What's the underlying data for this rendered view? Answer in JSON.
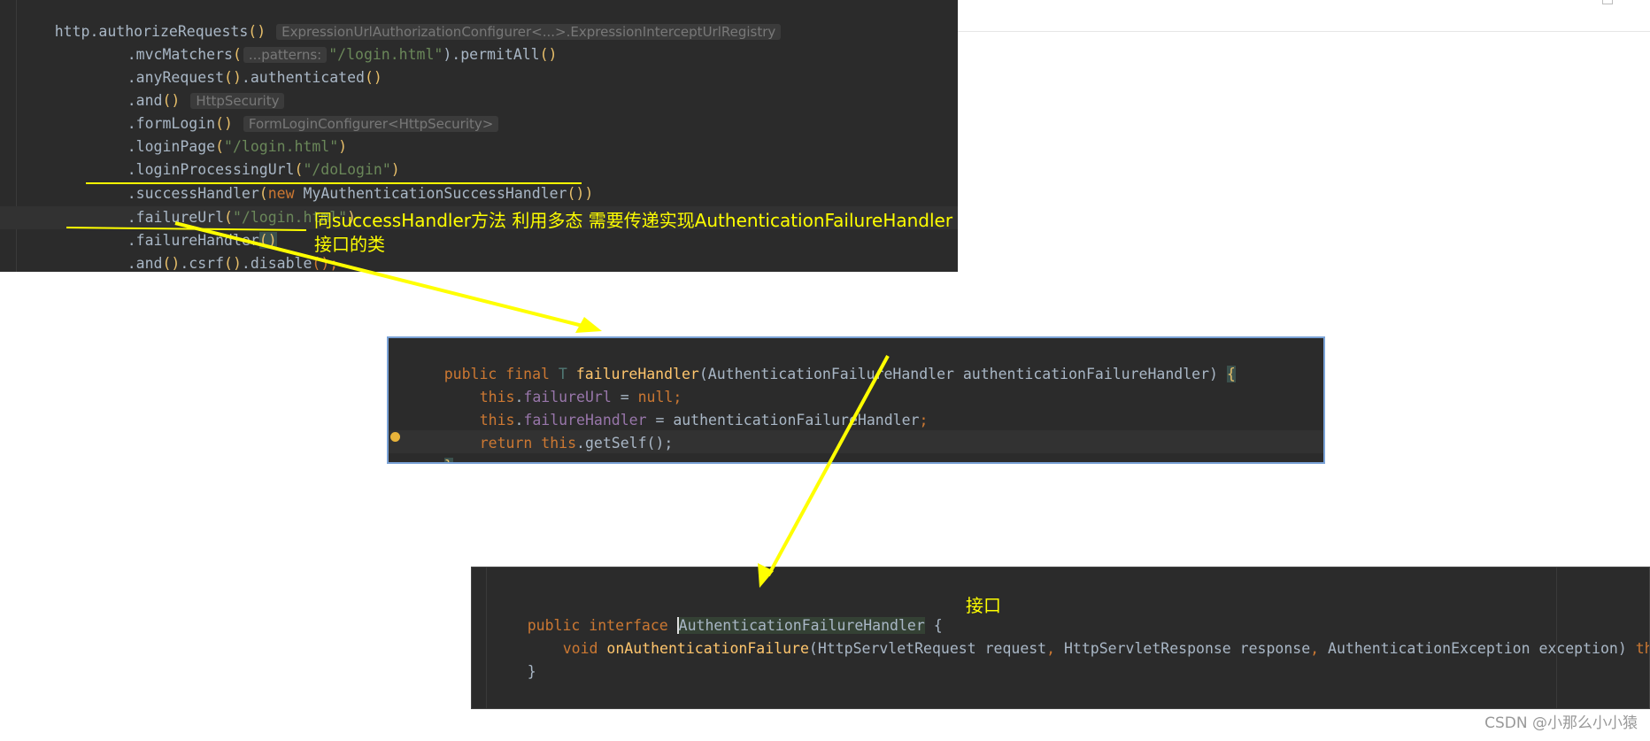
{
  "panel1": {
    "line1": {
      "a": "http.authorizeRequests",
      "b": "()",
      "hint": "ExpressionUrlAuthorizationConfigurer<...>.ExpressionInterceptUrlRegistry"
    },
    "line2": {
      "a": ".mvcMatchers",
      "b": "(",
      "hint": "...patterns:",
      "c": "\"/login.html\"",
      "d": ").permitAll",
      "e": "()"
    },
    "line3": {
      "a": ".anyRequest",
      "b": "()",
      "c": ".authenticated",
      "d": "()"
    },
    "line4": {
      "a": ".and",
      "b": "()",
      "hint": "HttpSecurity"
    },
    "line5": {
      "a": ".formLogin",
      "b": "()",
      "hint": "FormLoginConfigurer<HttpSecurity>"
    },
    "line6": {
      "a": ".loginPage",
      "b": "(",
      "c": "\"/login.html\"",
      "d": ")"
    },
    "line7": {
      "a": ".loginProcessingUrl",
      "b": "(",
      "c": "\"/doLogin\"",
      "d": ")"
    },
    "line8": {
      "a": ".successHandler",
      "b": "(",
      "c": "new",
      "d": " MyAuthenticationSuccessHandler",
      "e": "())"
    },
    "line9": {
      "a": ".failureUrl",
      "b": "(",
      "c": "\"/login.html\"",
      "d": ")"
    },
    "line10": {
      "a": ".failureHandler",
      "b": "()"
    },
    "line11": {
      "a": ".and",
      "b": "()",
      "c": ".csrf",
      "d": "()",
      "e": ".disable",
      "f": "();"
    }
  },
  "annotation1": {
    "line1": "同successHandler方法 利用多态 需要传递实现AuthenticationFailureHandler",
    "line2": "接口的类"
  },
  "panel2": {
    "line1": {
      "kw1": "public",
      "kw2": " final",
      "t": " T ",
      "fn": "failureHandler",
      "rest": "(AuthenticationFailureHandler authenticationFailureHandler) ",
      "brace": "{"
    },
    "line2": {
      "kw": "this",
      "dot": ".",
      "fld": "failureUrl",
      "eq": " = ",
      "nul": "null",
      "semi": ";"
    },
    "line3": {
      "kw": "this",
      "dot": ".",
      "fld": "failureHandler",
      "eq": " = authenticationFailureHandler",
      "semi": ";"
    },
    "line4": {
      "kw": "return",
      "kw2": " this",
      "rest": ".getSelf();"
    },
    "line5": {
      "brace": "}"
    }
  },
  "panel3": {
    "line1": {
      "kw1": "public",
      "kw2": " interface ",
      "name": "AuthenticationFailureHandler",
      "rest": " {"
    },
    "line2": {
      "kw": "void ",
      "fn": "onAuthenticationFailure",
      "p1": "(HttpServletRequest request",
      "c1": ", ",
      "p2": "HttpServletResponse response",
      "c2": ", ",
      "p3": "AuthenticationException exception) ",
      "thr": "thro"
    },
    "line3": {
      "brace": "}"
    }
  },
  "annotation2": "接口",
  "watermark": "CSDN @小那么小小猿",
  "colors": {
    "annotation": "#ffff00",
    "editor_bg": "#2b2b2b",
    "keyword": "#cc7832",
    "string": "#6a8759",
    "method": "#ffc66d",
    "field": "#9876aa"
  }
}
